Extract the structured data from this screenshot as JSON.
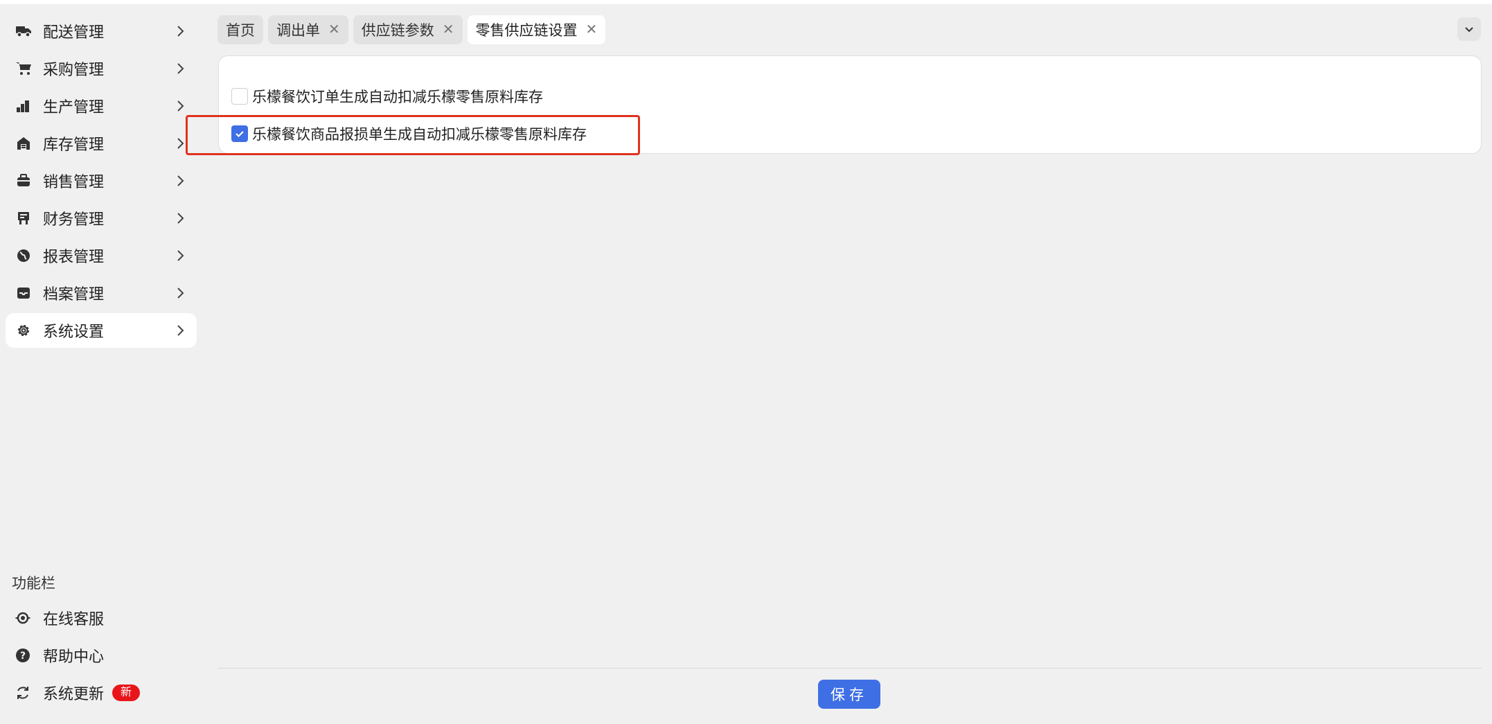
{
  "sidebar": {
    "items": [
      {
        "label": "配送管理",
        "icon": "truck-icon"
      },
      {
        "label": "采购管理",
        "icon": "cart-icon"
      },
      {
        "label": "生产管理",
        "icon": "factory-icon"
      },
      {
        "label": "库存管理",
        "icon": "warehouse-icon"
      },
      {
        "label": "销售管理",
        "icon": "briefcase-icon"
      },
      {
        "label": "财务管理",
        "icon": "finance-icon"
      },
      {
        "label": "报表管理",
        "icon": "globe-icon"
      },
      {
        "label": "档案管理",
        "icon": "archive-icon"
      },
      {
        "label": "系统设置",
        "icon": "gear-icon"
      }
    ],
    "function_bar": {
      "title": "功能栏",
      "items": [
        {
          "label": "在线客服",
          "icon": "customer-service-icon"
        },
        {
          "label": "帮助中心",
          "icon": "help-icon"
        },
        {
          "label": "系统更新",
          "icon": "refresh-icon",
          "badge": "新"
        }
      ]
    }
  },
  "tabs": [
    {
      "label": "首页",
      "closable": false
    },
    {
      "label": "调出单",
      "closable": true
    },
    {
      "label": "供应链参数",
      "closable": true
    },
    {
      "label": "零售供应链设置",
      "closable": true,
      "active": true
    }
  ],
  "settings": {
    "options": [
      {
        "label": "乐檬餐饮订单生成自动扣减乐檬零售原料库存",
        "checked": false
      },
      {
        "label": "乐檬餐饮商品报损单生成自动扣减乐檬零售原料库存",
        "checked": true
      }
    ]
  },
  "footer": {
    "save_label": "保存"
  },
  "colors": {
    "primary": "#3e6fe4",
    "badge": "#e8161b",
    "highlight": "#e0321e"
  }
}
